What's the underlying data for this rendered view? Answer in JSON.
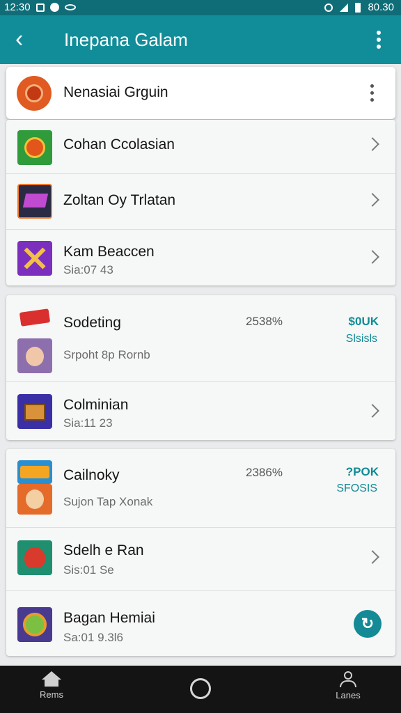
{
  "status_bar": {
    "time": "12:30",
    "battery": "80.30"
  },
  "app_bar": {
    "title": "Inepana Galam",
    "back_icon": "arrow-back-icon",
    "menu_icon": "more-vertical-icon"
  },
  "header_card": {
    "name": "Nenasiai Grguin"
  },
  "groups": [
    {
      "rows": [
        {
          "name": "Cohan Ccolasian",
          "sub": "",
          "icon": "sun-emblem-icon"
        },
        {
          "name": "Zoltan Oy Trlatan",
          "sub": "",
          "icon": "game-logo-icon"
        },
        {
          "name": "Kam Beaccen",
          "sub": "Sia:07 43",
          "icon": "crossed-swords-icon"
        }
      ]
    },
    {
      "rows": [
        {
          "name": "Sodeting",
          "sub": "Srpoht 8p Rornb",
          "percent": "2538%",
          "stat_top": "$0UK",
          "stat_bottom": "Slsisls",
          "icon": "badge-logo-icon",
          "icon2": "character-avatar-icon"
        },
        {
          "name": "Colminian",
          "sub": "Sia:11 23",
          "icon": "treasure-box-icon"
        }
      ]
    },
    {
      "rows": [
        {
          "name": "Cailnoky",
          "sub": "Sujon Tap Xonak",
          "percent": "2386%",
          "stat_top": "?POK",
          "stat_bottom": "SFOSIS",
          "icon": "candy-banner-icon",
          "icon2": "hero-face-icon"
        },
        {
          "name": "Sdelh e Ran",
          "sub": "Sis:01 Se",
          "icon": "dragon-icon"
        },
        {
          "name": "Bagan Hemiai",
          "sub": "Sa:01 9.3l6",
          "icon": "orb-icon",
          "action_icon": "refresh-icon"
        }
      ]
    }
  ],
  "bottom_nav": [
    {
      "label": "Rems",
      "icon": "home-icon"
    },
    {
      "label": "",
      "icon": "circle-home-icon"
    },
    {
      "label": "Lanes",
      "icon": "person-icon"
    }
  ]
}
